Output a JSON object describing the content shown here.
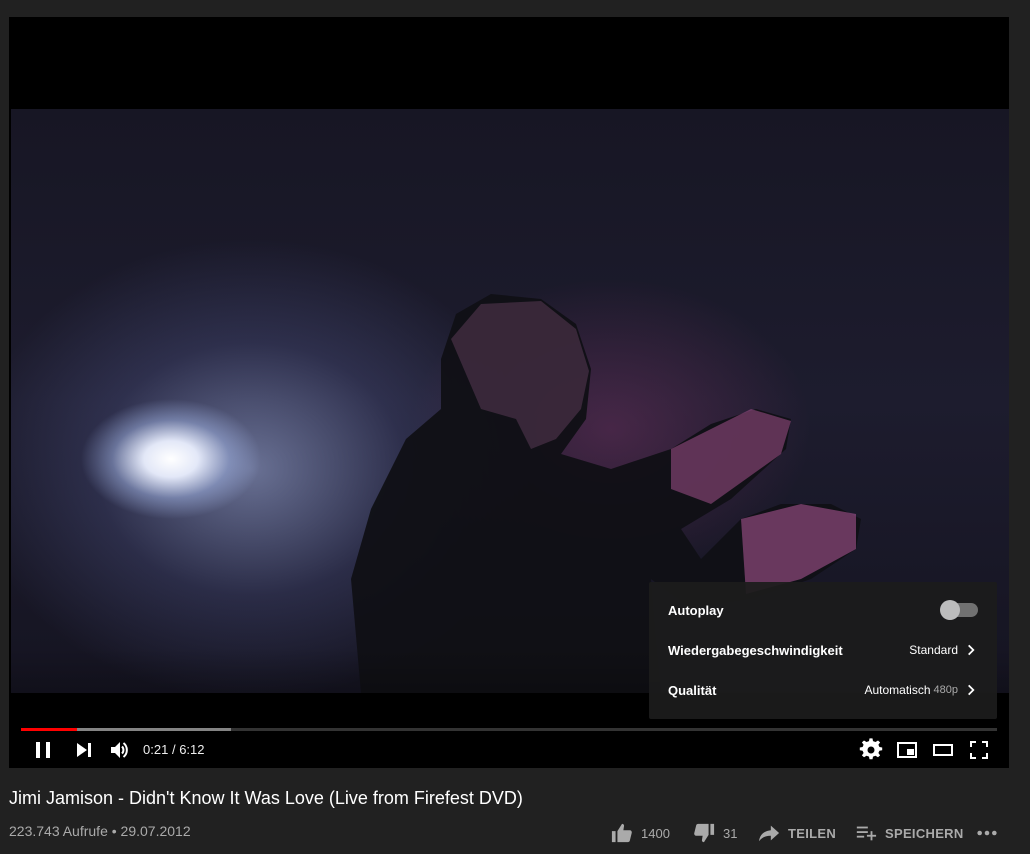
{
  "player": {
    "time_current": "0:21",
    "time_separator": "/",
    "time_total": "6:12",
    "progress_played": 0.057,
    "progress_loaded": 0.215
  },
  "settings_menu": {
    "autoplay_label": "Autoplay",
    "autoplay_on": false,
    "speed_label": "Wiedergabegeschwindigkeit",
    "speed_value": "Standard",
    "quality_label": "Qualität",
    "quality_value": "Automatisch",
    "quality_sub": "480p"
  },
  "video": {
    "title": "Jimi Jamison - Didn't Know It Was Love (Live from Firefest DVD)",
    "views_date": "223.743 Aufrufe • 29.07.2012"
  },
  "actions": {
    "like_count": "1400",
    "dislike_count": "31",
    "share_label": "TEILEN",
    "save_label": "SPEICHERN"
  },
  "icons": {
    "pause": "pause-icon",
    "next": "next-icon",
    "volume": "volume-icon",
    "settings": "gear-icon",
    "miniplayer": "miniplayer-icon",
    "theater": "theater-icon",
    "fullscreen": "fullscreen-icon",
    "like": "thumbs-up-icon",
    "dislike": "thumbs-down-icon",
    "share": "share-arrow-icon",
    "save": "playlist-add-icon",
    "more": "more-dots-icon"
  },
  "colors": {
    "progress_played": "#ff0000",
    "page_background": "#212121"
  }
}
